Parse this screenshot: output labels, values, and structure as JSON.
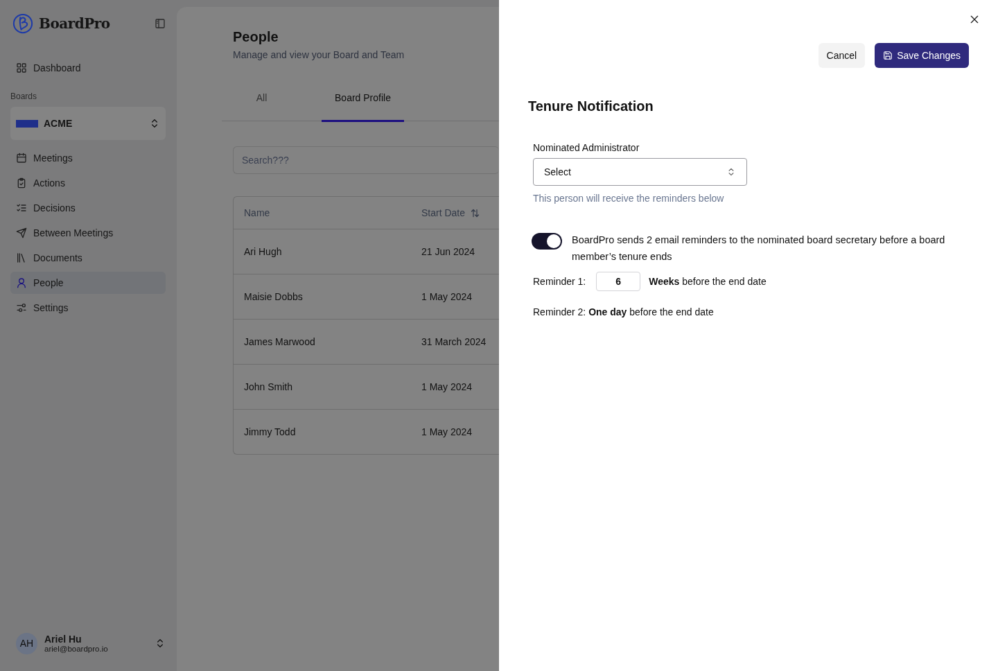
{
  "sidebar": {
    "brand": "BoardPro",
    "top_nav": [
      {
        "label": "Dashboard",
        "selected": false
      }
    ],
    "section_label": "Boards",
    "board": {
      "name": "ACME"
    },
    "nav": [
      {
        "label": "Meetings",
        "selected": false
      },
      {
        "label": "Actions",
        "selected": false
      },
      {
        "label": "Decisions",
        "selected": false
      },
      {
        "label": "Between Meetings",
        "selected": false
      },
      {
        "label": "Documents",
        "selected": false
      },
      {
        "label": "People",
        "selected": true
      },
      {
        "label": "Settings",
        "selected": false
      }
    ],
    "user": {
      "initials": "AH",
      "name": "Ariel Hu",
      "email": "ariel@boardpro.io"
    }
  },
  "page": {
    "title": "People",
    "subtitle": "Manage and view your Board and Team",
    "tabs": [
      {
        "label": "All",
        "selected": false
      },
      {
        "label": "Board Profile",
        "selected": true
      }
    ],
    "search": {
      "placeholder": "Search???"
    },
    "table": {
      "columns": [
        "Name",
        "Start Date"
      ],
      "rows": [
        [
          "Ari Hugh",
          "21 Jun 2024"
        ],
        [
          "Maisie Dobbs",
          "1 May 2024"
        ],
        [
          "James Marwood",
          "31 March 2024"
        ],
        [
          "John Smith",
          "1 May 2024"
        ],
        [
          "Jimmy Todd",
          "1 May 2024"
        ]
      ]
    }
  },
  "drawer": {
    "buttons": [
      {
        "label": "Cancel",
        "kind": "secondary"
      },
      {
        "label": "Save Changes",
        "kind": "primary"
      }
    ],
    "title": "Tenure Notification",
    "field": {
      "label": "Nominated Administrator",
      "value": "Select",
      "hint": "This person will receive the reminders below"
    },
    "toggle": {
      "on": true,
      "text": "BoardPro sends 2 email reminders to the nominated board secretary before a board member’s tenure ends"
    },
    "reminder_1": {
      "label": "Reminder 1:",
      "value": "6",
      "text": "**Weeks** before the end date"
    },
    "reminder_2": {
      "text": "Reminder 2: **One day** before the end date"
    }
  }
}
